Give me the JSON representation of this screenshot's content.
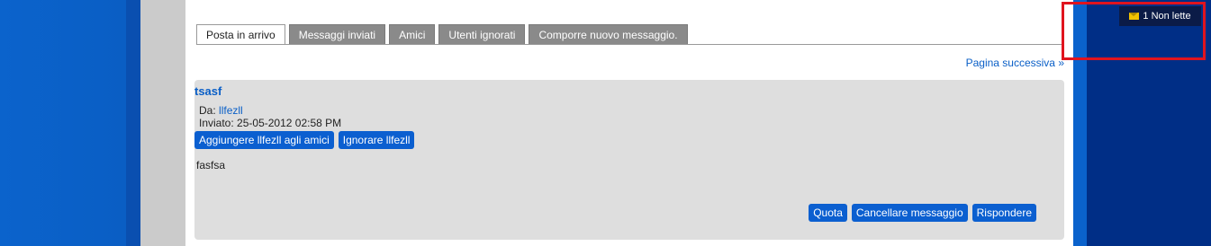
{
  "unread_badge": {
    "label": "1 Non lette",
    "icon": "envelope-icon"
  },
  "tabs": [
    {
      "label": "Posta in arrivo",
      "active": true
    },
    {
      "label": "Messaggi inviati",
      "active": false
    },
    {
      "label": "Amici",
      "active": false
    },
    {
      "label": "Utenti ignorati",
      "active": false
    },
    {
      "label": "Comporre nuovo messaggio.",
      "active": false
    }
  ],
  "pagination": {
    "next_label": "Pagina successiva »"
  },
  "message": {
    "title": "tsasf",
    "from_label": "Da:",
    "from_user": "llfezll",
    "sent_label": "Inviato:",
    "sent_date": "25-05-2012 02:58 PM",
    "add_friend_label": "Aggiungere llfezll agli amici",
    "ignore_label": "Ignorare llfezll",
    "body": "fasfsa",
    "quote_label": "Quota",
    "delete_label": "Cancellare messaggio",
    "reply_label": "Rispondere"
  },
  "colors": {
    "accent": "#0b5fd0",
    "highlight_border": "#e0141e",
    "sidebar_dark": "#002e86"
  }
}
